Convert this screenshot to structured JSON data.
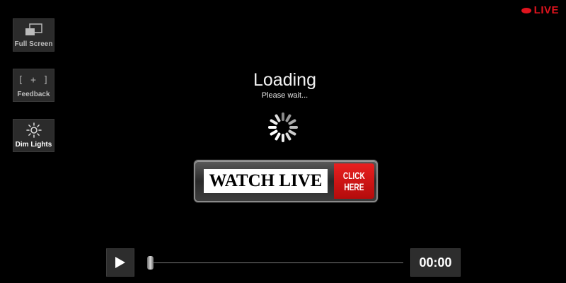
{
  "live": {
    "label": "LIVE",
    "color": "#e0141e"
  },
  "sidebar": {
    "items": [
      {
        "label": "Full Screen",
        "icon": "fullscreen-icon"
      },
      {
        "label": "Feedback",
        "icon": "feedback-icon",
        "glyph": "[ + ]"
      },
      {
        "label": "Dim Lights",
        "icon": "sun-icon"
      }
    ]
  },
  "loading": {
    "title": "Loading",
    "subtitle": "Please wait..."
  },
  "banner": {
    "main_text": "WATCH LIVE",
    "cta_line1": "CLICK",
    "cta_line2": "HERE",
    "cta_color": "#d41414"
  },
  "player": {
    "play_icon": "play-icon",
    "time": "00:00",
    "progress": 0
  }
}
